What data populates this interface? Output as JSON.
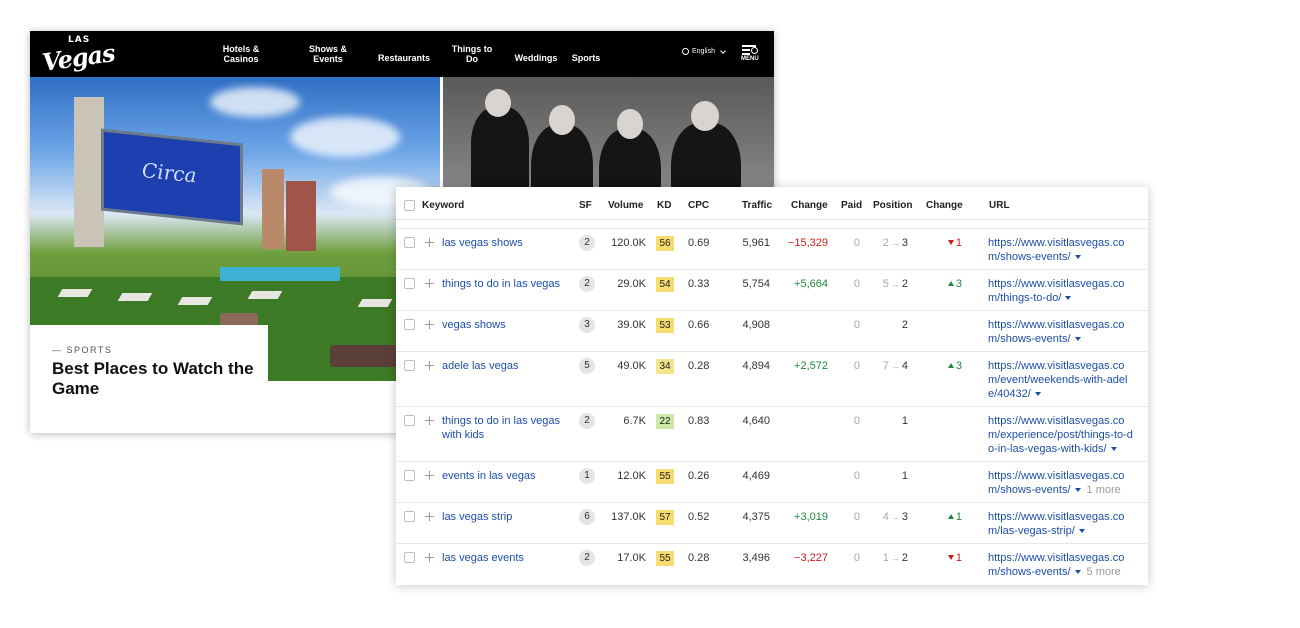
{
  "site": {
    "logo_small": "LAS",
    "logo_main": "Vegas",
    "nav": [
      {
        "line1": "Hotels &",
        "line2": "Casinos"
      },
      {
        "line1": "Shows &",
        "line2": "Events"
      },
      {
        "line1": "Restaurants",
        "line2": ""
      },
      {
        "line1": "Things to",
        "line2": "Do"
      },
      {
        "line1": "Weddings",
        "line2": ""
      },
      {
        "line1": "Sports",
        "line2": ""
      }
    ],
    "language": "English",
    "menu_label": "MENU",
    "hero_sign": "Circa",
    "caption_category": "— SPORTS",
    "caption_title": "Best Places to Watch the Game"
  },
  "table": {
    "headers": {
      "keyword": "Keyword",
      "sf": "SF",
      "volume": "Volume",
      "kd": "KD",
      "cpc": "CPC",
      "traffic": "Traffic",
      "change": "Change",
      "paid": "Paid",
      "position": "Position",
      "pos_change": "Change",
      "url": "URL"
    },
    "rows": [
      {
        "keyword": "las vegas shows",
        "keyword2": "",
        "sf": "2",
        "volume": "120.0K",
        "kd": "56",
        "kd_color": "#f7dc6f",
        "cpc": "0.69",
        "traffic": "5,961",
        "change": "−15,329",
        "change_dir": "down",
        "paid": "0",
        "pos_from": "2",
        "pos_to": "3",
        "pos_change": "1",
        "pos_change_dir": "down",
        "url1": "https://www.visitlasvegas.co",
        "url2": "m/shows-events/",
        "url3": "",
        "more": ""
      },
      {
        "keyword": "things to do in las vegas",
        "keyword2": "",
        "sf": "2",
        "volume": "29.0K",
        "kd": "54",
        "kd_color": "#f7dc6f",
        "cpc": "0.33",
        "traffic": "5,754",
        "change": "+5,664",
        "change_dir": "up",
        "paid": "0",
        "pos_from": "5",
        "pos_to": "2",
        "pos_change": "3",
        "pos_change_dir": "up",
        "url1": "https://www.visitlasvegas.co",
        "url2": "m/things-to-do/",
        "url3": "",
        "more": ""
      },
      {
        "keyword": "vegas shows",
        "keyword2": "",
        "sf": "3",
        "volume": "39.0K",
        "kd": "53",
        "kd_color": "#f7dc6f",
        "cpc": "0.66",
        "traffic": "4,908",
        "change": "",
        "change_dir": "",
        "paid": "0",
        "pos_from": "",
        "pos_to": "2",
        "pos_change": "",
        "pos_change_dir": "",
        "url1": "https://www.visitlasvegas.co",
        "url2": "m/shows-events/",
        "url3": "",
        "more": ""
      },
      {
        "keyword": "adele las vegas",
        "keyword2": "",
        "sf": "5",
        "volume": "49.0K",
        "kd": "34",
        "kd_color": "#f3e38a",
        "cpc": "0.28",
        "traffic": "4,894",
        "change": "+2,572",
        "change_dir": "up",
        "paid": "0",
        "pos_from": "7",
        "pos_to": "4",
        "pos_change": "3",
        "pos_change_dir": "up",
        "url1": "https://www.visitlasvegas.co",
        "url2": "m/event/weekends-with-adel",
        "url3": "e/40432/",
        "more": ""
      },
      {
        "keyword": "things to do in las vegas",
        "keyword2": "with kids",
        "sf": "2",
        "volume": "6.7K",
        "kd": "22",
        "kd_color": "#cde8a7",
        "cpc": "0.83",
        "traffic": "4,640",
        "change": "",
        "change_dir": "",
        "paid": "0",
        "pos_from": "",
        "pos_to": "1",
        "pos_change": "",
        "pos_change_dir": "",
        "url1": "https://www.visitlasvegas.co",
        "url2": "m/experience/post/things-to-d",
        "url3": "o-in-las-vegas-with-kids/",
        "more": ""
      },
      {
        "keyword": "events in las vegas",
        "keyword2": "",
        "sf": "1",
        "volume": "12.0K",
        "kd": "55",
        "kd_color": "#f7dc6f",
        "cpc": "0.26",
        "traffic": "4,469",
        "change": "",
        "change_dir": "",
        "paid": "0",
        "pos_from": "",
        "pos_to": "1",
        "pos_change": "",
        "pos_change_dir": "",
        "url1": "https://www.visitlasvegas.co",
        "url2": "m/shows-events/",
        "url3": "",
        "more": "1 more"
      },
      {
        "keyword": "las vegas strip",
        "keyword2": "",
        "sf": "6",
        "volume": "137.0K",
        "kd": "57",
        "kd_color": "#f7dc6f",
        "cpc": "0.52",
        "traffic": "4,375",
        "change": "+3,019",
        "change_dir": "up",
        "paid": "0",
        "pos_from": "4",
        "pos_to": "3",
        "pos_change": "1",
        "pos_change_dir": "up",
        "url1": "https://www.visitlasvegas.co",
        "url2": "m/las-vegas-strip/",
        "url3": "",
        "more": ""
      },
      {
        "keyword": "las vegas events",
        "keyword2": "",
        "sf": "2",
        "volume": "17.0K",
        "kd": "55",
        "kd_color": "#f7dc6f",
        "cpc": "0.28",
        "traffic": "3,496",
        "change": "−3,227",
        "change_dir": "down",
        "paid": "0",
        "pos_from": "1",
        "pos_to": "2",
        "pos_change": "1",
        "pos_change_dir": "down",
        "url1": "https://www.visitlasvegas.co",
        "url2": "m/shows-events/",
        "url3": "",
        "more": "5 more"
      }
    ]
  },
  "colors": {
    "up": "#1c8a3a",
    "down": "#d01c1c",
    "link": "#1d4fa8"
  }
}
